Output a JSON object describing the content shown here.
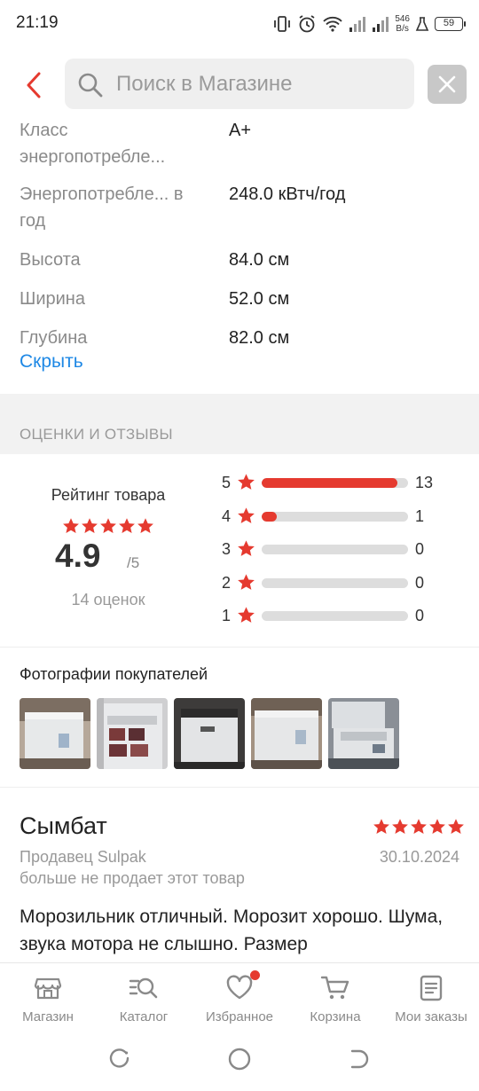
{
  "status_bar": {
    "time": "21:19",
    "net_speed_value": "546",
    "net_speed_unit": "B/s",
    "battery": "59"
  },
  "search": {
    "placeholder": "Поиск в Магазине"
  },
  "specs": [
    {
      "name": "Класс энергопотребле...",
      "value": "A+"
    },
    {
      "name": "Энергопотребле... в год",
      "value": "248.0 кВтч/год"
    },
    {
      "name": "Высота",
      "value": "84.0 см"
    },
    {
      "name": "Ширина",
      "value": "52.0 см"
    },
    {
      "name": "Глубина",
      "value": "82.0 см"
    }
  ],
  "hide_link": "Скрыть",
  "reviews_section_title": "ОЦЕНКИ И ОТЗЫВЫ",
  "rating": {
    "label": "Рейтинг товара",
    "score": "4.9",
    "max": "/5",
    "count_text": "14 оценок",
    "stars": 5,
    "distribution": [
      {
        "stars": "5",
        "count": "13",
        "fraction": 0.93
      },
      {
        "stars": "4",
        "count": "1",
        "fraction": 0.07
      },
      {
        "stars": "3",
        "count": "0",
        "fraction": 0
      },
      {
        "stars": "2",
        "count": "0",
        "fraction": 0
      },
      {
        "stars": "1",
        "count": "0",
        "fraction": 0
      }
    ]
  },
  "photos": {
    "title": "Фотографии покупателей",
    "count": 5
  },
  "review": {
    "author": "Сымбат",
    "stars": 5,
    "seller": "Продавец Sulpak",
    "date": "30.10.2024",
    "note": "больше не продает этот товар",
    "text": "Морозильник отличный. Морозит хорошо. Шума, звука мотора не слышно. Размер"
  },
  "bottom_nav": [
    {
      "label": "Магазин",
      "icon": "store-icon"
    },
    {
      "label": "Каталог",
      "icon": "catalog-search-icon"
    },
    {
      "label": "Избранное",
      "icon": "heart-icon",
      "badge": true
    },
    {
      "label": "Корзина",
      "icon": "cart-icon"
    },
    {
      "label": "Мои заказы",
      "icon": "orders-icon"
    }
  ],
  "colors": {
    "accent": "#e53a2f",
    "link": "#1e88e5",
    "muted": "#8a8a8a"
  }
}
